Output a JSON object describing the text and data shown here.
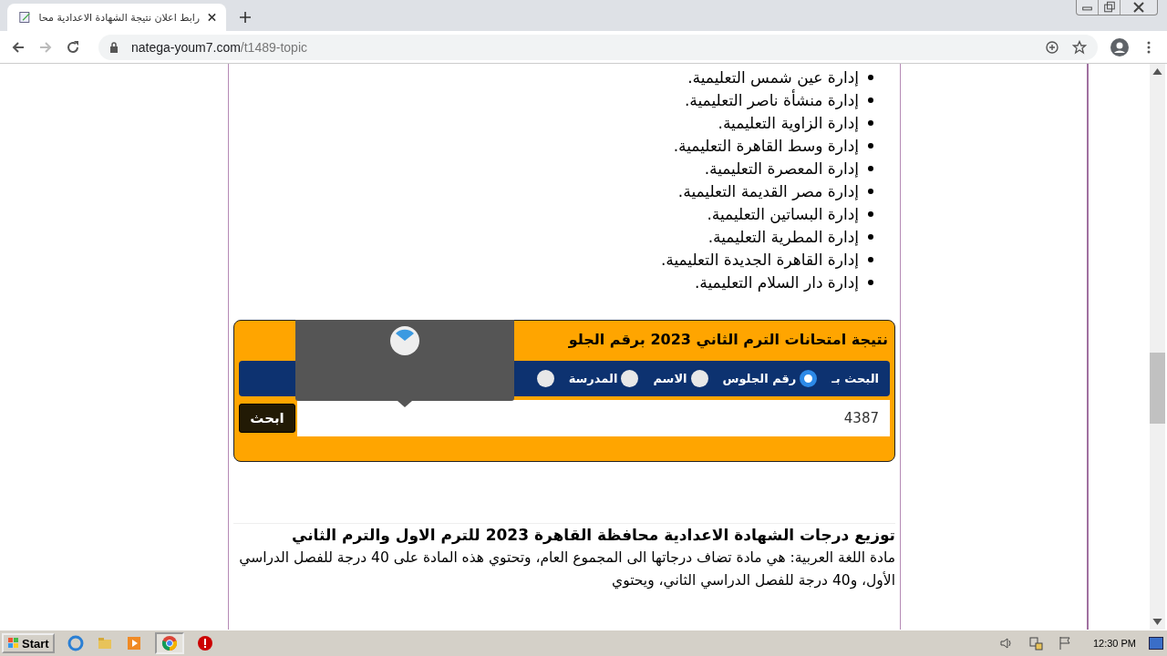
{
  "browser": {
    "tab": {
      "title": "رابط اعلان نتيجة الشهادة الاعدادية محا",
      "selected": true
    },
    "url_host": "natega-youm7.com",
    "url_path": "/t1489-topic"
  },
  "list_items": [
    "إدارة عين شمس التعليمية.",
    "إدارة منشأة ناصر التعليمية.",
    "إدارة الزاوية التعليمية.",
    "إدارة وسط القاهرة التعليمية.",
    "إدارة المعصرة التعليمية.",
    "إدارة مصر القديمة التعليمية.",
    "إدارة البساتين التعليمية.",
    "إدارة المطرية التعليمية.",
    "إدارة القاهرة الجديدة التعليمية.",
    "إدارة دار السلام التعليمية."
  ],
  "result_box": {
    "title": "نتيجة امتحانات الترم الثاني 2023 برقم الجلو",
    "search_by_label": "البحث بـ",
    "options": [
      {
        "label": "رقم الجلوس",
        "selected": true
      },
      {
        "label": "الاسم",
        "selected": false
      },
      {
        "label": "المدرسة",
        "selected": false
      },
      {
        "selected": false
      }
    ],
    "input_value": "4387",
    "button": "ابحث"
  },
  "article": {
    "heading": "توزيع درجات الشهادة الاعدادية محافظة القاهرة 2023 للترم الاول والترم الثاني",
    "paragraph": "مادة اللغة العربية: هي مادة تضاف درجاتها الى المجموع العام، وتحتوي هذه المادة على 40 درجة للفصل الدراسي الأول، و40 درجة للفصل الدراسي الثاني، ويحتوي"
  },
  "taskbar": {
    "start": "Start",
    "clock": "12:30 PM"
  }
}
